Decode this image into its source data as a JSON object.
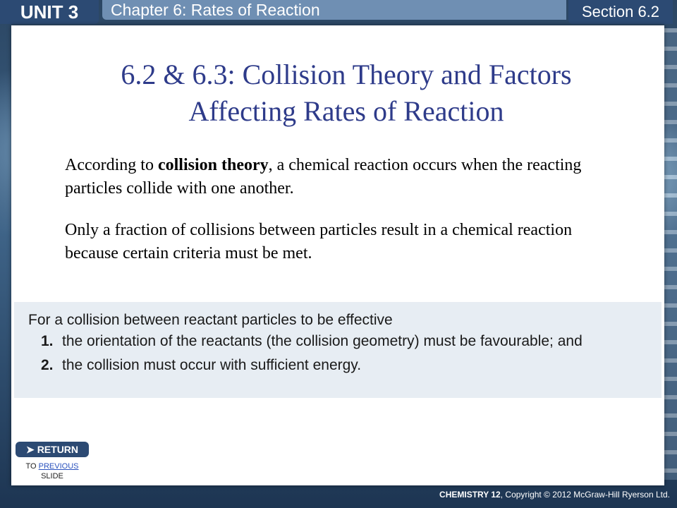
{
  "header": {
    "unit": "UNIT 3",
    "chapter": "Chapter 6: Rates of Reaction",
    "section": "Section 6.2"
  },
  "slide": {
    "title_line1": "6.2 & 6.3: Collision Theory and Factors",
    "title_line2": "Affecting Rates of Reaction",
    "para1_pre": "According to ",
    "para1_bold": "collision theory",
    "para1_post": ", a chemical reaction occurs when the reacting particles collide with one another.",
    "para2": "Only a fraction of collisions between particles result in a chemical reaction because certain criteria must be met."
  },
  "criteria": {
    "intro": "For a collision between reactant particles to be effective",
    "items": [
      {
        "num": "1.",
        "text": "the orientation of the reactants (the collision geometry) must be favourable; and"
      },
      {
        "num": "2.",
        "text": "the collision must occur with sufficient energy."
      }
    ]
  },
  "return_nav": {
    "button_label": "RETURN",
    "caption_to": "TO",
    "caption_link": "PREVIOUS",
    "caption_end": "SLIDE"
  },
  "footer": {
    "book": "CHEMISTRY 12",
    "copyright": ", Copyright © 2012 McGraw-Hill Ryerson Ltd."
  }
}
